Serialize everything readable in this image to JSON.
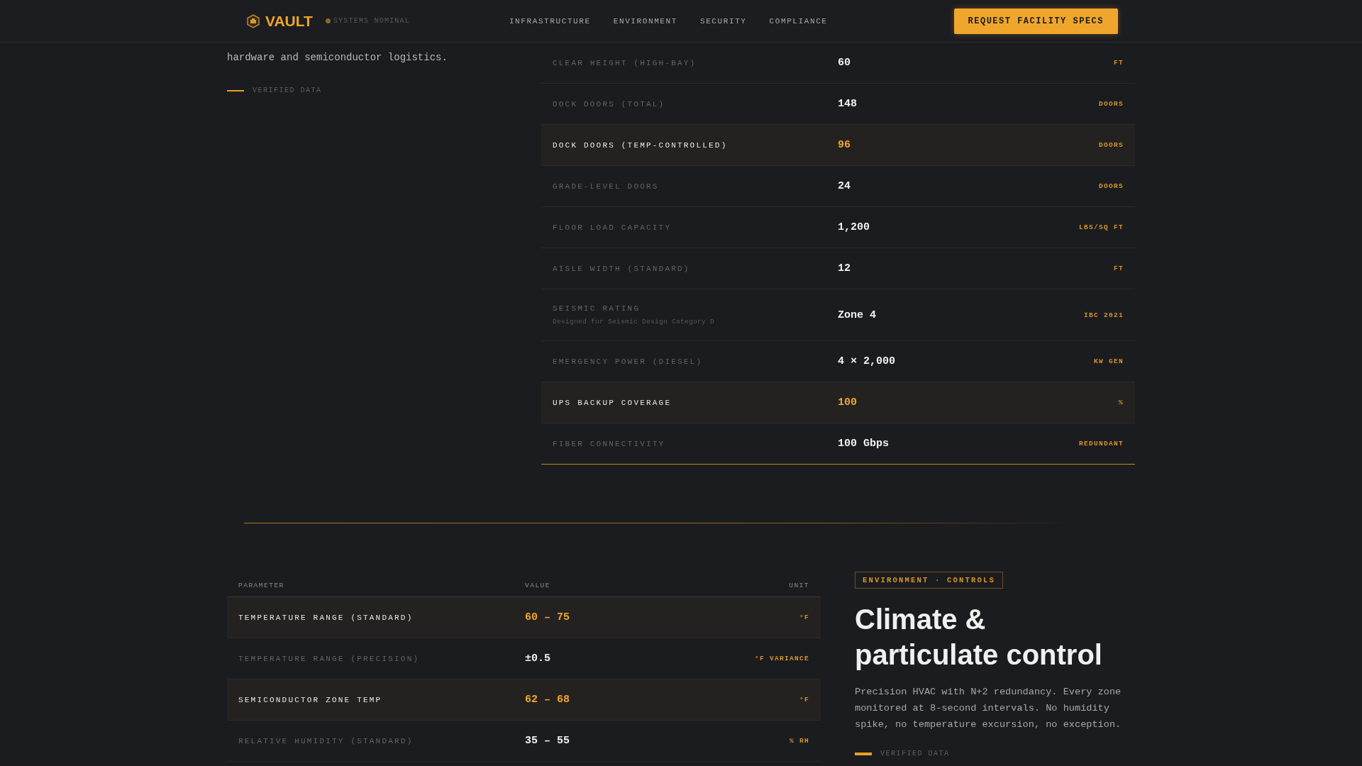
{
  "header": {
    "brand": "VAULT",
    "status": "SYSTEMS NOMINAL",
    "nav": [
      {
        "label": "INFRASTRUCTURE"
      },
      {
        "label": "ENVIRONMENT"
      },
      {
        "label": "SECURITY"
      },
      {
        "label": "COMPLIANCE"
      }
    ],
    "cta": "REQUEST FACILITY SPECS"
  },
  "infrastructure": {
    "intro": "hardware and semiconductor logistics.",
    "badge": "VERIFIED DATA",
    "specs": [
      {
        "label": "CLEAR HEIGHT (HIGH-BAY)",
        "value": "60",
        "unit": "FT",
        "highlight": false
      },
      {
        "label": "DOCK DOORS (TOTAL)",
        "value": "148",
        "unit": "DOORS",
        "highlight": false
      },
      {
        "label": "DOCK DOORS (TEMP-CONTROLLED)",
        "value": "96",
        "unit": "DOORS",
        "highlight": true
      },
      {
        "label": "GRADE-LEVEL DOORS",
        "value": "24",
        "unit": "DOORS",
        "highlight": false
      },
      {
        "label": "FLOOR LOAD CAPACITY",
        "value": "1,200",
        "unit": "LBS/SQ FT",
        "highlight": false
      },
      {
        "label": "AISLE WIDTH (STANDARD)",
        "value": "12",
        "unit": "FT",
        "highlight": false
      },
      {
        "label": "SEISMIC RATING",
        "note": "Designed for Seismic Design Category D",
        "value": "Zone 4",
        "unit": "IBC 2021",
        "highlight": false
      },
      {
        "label": "EMERGENCY POWER (DIESEL)",
        "value": "4 × 2,000",
        "unit": "KW GEN",
        "highlight": false
      },
      {
        "label": "UPS BACKUP COVERAGE",
        "value": "100",
        "unit": "%",
        "highlight": true
      },
      {
        "label": "FIBER CONNECTIVITY",
        "value": "100 Gbps",
        "unit": "REDUNDANT",
        "highlight": false
      }
    ]
  },
  "environment": {
    "columns": [
      "PARAMETER",
      "VALUE",
      "UNIT"
    ],
    "rows": [
      {
        "label": "TEMPERATURE RANGE (STANDARD)",
        "value": "60 – 75",
        "unit": "°F",
        "highlight": true
      },
      {
        "label": "TEMPERATURE RANGE (PRECISION)",
        "value": "±0.5",
        "unit": "°F VARIANCE",
        "highlight": false
      },
      {
        "label": "SEMICONDUCTOR ZONE TEMP",
        "value": "62 – 68",
        "unit": "°F",
        "highlight": true
      },
      {
        "label": "RELATIVE HUMIDITY (STANDARD)",
        "value": "35 – 55",
        "unit": "% RH",
        "highlight": false
      }
    ],
    "tag": "ENVIRONMENT · CONTROLS",
    "heading": "Climate & particulate control",
    "body": "Precision HVAC with N+2 redundancy. Every zone monitored at 8-second intervals. No humidity spike, no temperature excursion, no exception.",
    "badge": "VERIFIED DATA"
  }
}
